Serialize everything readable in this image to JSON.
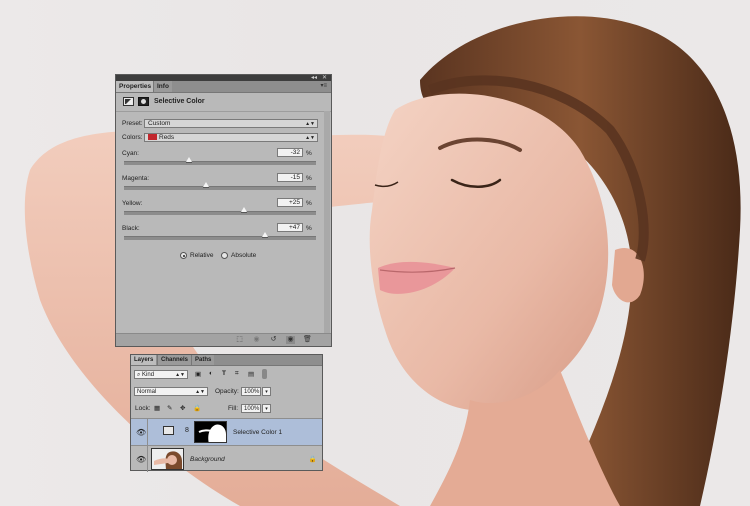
{
  "properties": {
    "tabs": [
      "Properties",
      "Info"
    ],
    "title": "Selective Color",
    "preset_label": "Preset:",
    "preset_value": "Custom",
    "colors_label": "Colors:",
    "colors_value": "Reds",
    "sliders": [
      {
        "label": "Cyan:",
        "value": "-32",
        "percent": -32
      },
      {
        "label": "Magenta:",
        "value": "-15",
        "percent": -15
      },
      {
        "label": "Yellow:",
        "value": "+25",
        "percent": 25
      },
      {
        "label": "Black:",
        "value": "+47",
        "percent": 47
      }
    ],
    "unit": "%",
    "method_options": [
      "Relative",
      "Absolute"
    ],
    "method_selected": "Relative",
    "swatch_color": "#c1272d"
  },
  "layers": {
    "tabs": [
      "Layers",
      "Channels",
      "Paths"
    ],
    "filter_kind": "Kind",
    "blend_mode": "Normal",
    "opacity_label": "Opacity:",
    "opacity_value": "100%",
    "lock_label": "Lock:",
    "fill_label": "Fill:",
    "fill_value": "100%",
    "items": [
      {
        "name": "Selective Color 1",
        "selected": true
      },
      {
        "name": "Background",
        "selected": false
      }
    ],
    "selection_color": "#adbed9"
  }
}
